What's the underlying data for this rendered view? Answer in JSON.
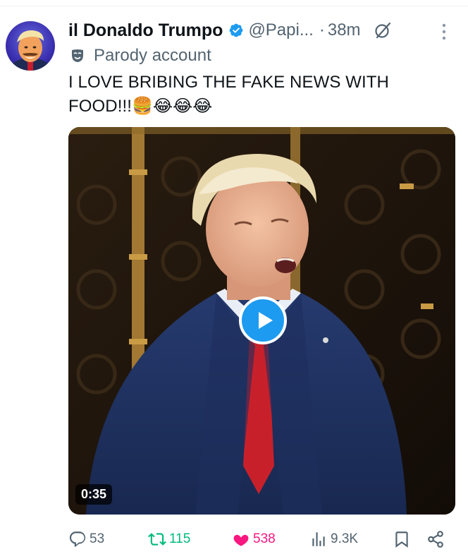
{
  "tweet": {
    "author": {
      "display_name": "il Donaldo Trumpo",
      "handle": "@Papi...",
      "verified": true,
      "badge_color": "#1d9bf0",
      "label": "Parody account"
    },
    "separator": "·",
    "timestamp": "38m",
    "text": "I LOVE BRIBING THE FAKE NEWS WITH FOOD!!!🍔😂😂😂",
    "media": {
      "type": "video",
      "duration": "0:35",
      "play_icon": "play-icon"
    },
    "actions": {
      "replies": "53",
      "reposts": "115",
      "likes": "538",
      "views": "9.3K",
      "liked": true,
      "repost_color": "#00ba7c",
      "like_color": "#f91880"
    },
    "icons": [
      "verified-badge-icon",
      "grok-icon",
      "more-options-icon",
      "parody-mask-icon",
      "reply-icon",
      "repost-icon",
      "heart-icon",
      "views-icon",
      "bookmark-icon",
      "share-icon"
    ]
  }
}
